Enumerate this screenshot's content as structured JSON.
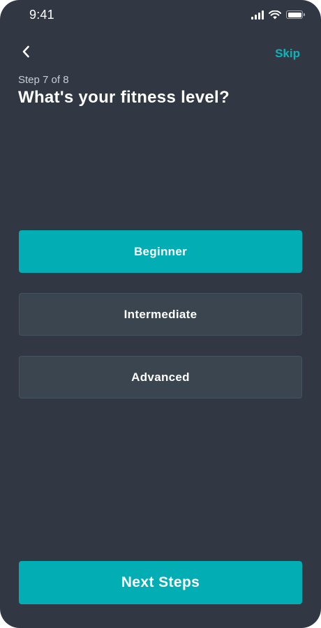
{
  "status_bar": {
    "time": "9:41",
    "icons": [
      "cellular-signal-icon",
      "wifi-icon",
      "battery-icon"
    ]
  },
  "header": {
    "back_icon": "chevron-left-icon",
    "skip_label": "Skip"
  },
  "step": {
    "label": "Step 7 of 8",
    "current": 7,
    "total": 8
  },
  "title": "What's your fitness level?",
  "options": [
    {
      "label": "Beginner",
      "selected": true
    },
    {
      "label": "Intermediate",
      "selected": false
    },
    {
      "label": "Advanced",
      "selected": false
    }
  ],
  "next_button": {
    "label": "Next Steps"
  },
  "colors": {
    "background": "#313843",
    "accent": "#03adb4",
    "option_unselected": "#3a4550",
    "skip_text": "#0db3b8"
  }
}
